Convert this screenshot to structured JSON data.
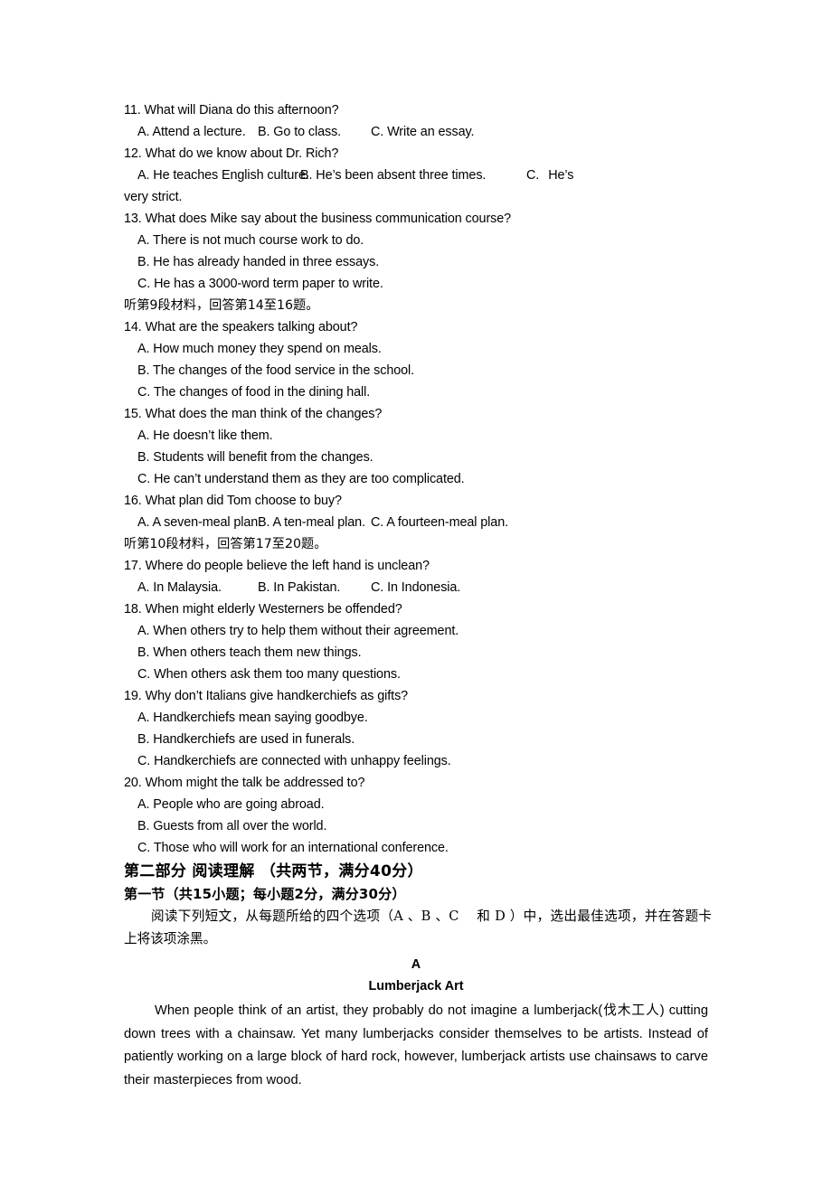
{
  "listening_questions": [
    {
      "id": "q11",
      "prompt": "11. What will Diana do this afternoon?",
      "layout": "row",
      "options": [
        "A. Attend a lecture.",
        "B. Go to class.",
        "C. Write an essay."
      ]
    },
    {
      "id": "q12",
      "prompt": "12. What do we know about Dr. Rich?",
      "layout": "row-wide",
      "options": [
        "A. He teaches English culture.",
        "B. He’s been absent three times.",
        "C.",
        "He’s"
      ],
      "continuation": "very strict."
    },
    {
      "id": "q13",
      "prompt": "13. What does Mike say about the business communication course?",
      "layout": "stacked",
      "options": [
        "A. There is not much course work to do.",
        "B. He has already handed in three essays.",
        "C. He has a 3000-word term paper to write."
      ]
    }
  ],
  "directive_9": "听第9段材料，回答第14至16题。",
  "listening_questions_2": [
    {
      "id": "q14",
      "prompt": "14. What are the speakers talking about?",
      "layout": "stacked",
      "options": [
        "A. How much money they spend on meals.",
        "B. The changes of the food service in the school.",
        "C. The changes of food in the dining hall."
      ]
    },
    {
      "id": "q15",
      "prompt": "15. What does the man think of the changes?",
      "layout": "stacked",
      "options": [
        "A. He doesn’t like them.",
        "B. Students will benefit from the changes.",
        "C. He can’t understand them as they are too complicated."
      ]
    },
    {
      "id": "q16",
      "prompt": "16. What plan did Tom choose to buy?",
      "layout": "row",
      "options": [
        "A. A seven-meal plan.",
        "B. A ten-meal plan.",
        "C. A fourteen-meal plan."
      ]
    }
  ],
  "directive_10": "听第10段材料，回答第17至20题。",
  "listening_questions_3": [
    {
      "id": "q17",
      "prompt": "17. Where do people believe the left hand is unclean?",
      "layout": "row",
      "options": [
        "A. In Malaysia.",
        "B. In Pakistan.",
        "C. In Indonesia."
      ]
    },
    {
      "id": "q18",
      "prompt": "18. When might elderly Westerners be offended?",
      "layout": "stacked",
      "options": [
        "A. When others try to help them without their agreement.",
        "B. When others teach them new things.",
        "C. When others ask them too many questions."
      ]
    },
    {
      "id": "q19",
      "prompt": "19. Why don’t Italians give handkerchiefs as gifts?",
      "layout": "stacked",
      "options": [
        "A. Handkerchiefs mean saying goodbye.",
        "B. Handkerchiefs are used in funerals.",
        "C. Handkerchiefs are connected with unhappy feelings."
      ]
    },
    {
      "id": "q20",
      "prompt": "20. Whom might the talk be addressed to?",
      "layout": "stacked",
      "options": [
        "A. People who are going abroad.",
        "B. Guests from all over the world.",
        "C. Those who will work for an international conference."
      ]
    }
  ],
  "part_two": {
    "heading": "第二部分  阅读理解  （共两节，满分40分）",
    "section_heading": "第一节（共15小题；每小题2分，满分30分）",
    "instruction": "阅读下列短文，从每题所给的四个选项（A 、B 、C 　和 D ）中，选出最佳选项，并在答题卡上将该项涂黑。"
  },
  "passage": {
    "label": "A",
    "title": "Lumberjack Art",
    "body_pre": "When people think of an artist, they probably do not imagine a lumberjack(",
    "body_gloss": "伐木工人",
    "body_post": ") cutting down trees with a chainsaw. Yet many lumberjacks consider themselves to be artists. Instead of patiently working on a large block of hard rock, however, lumberjack artists use chainsaws to carve their masterpieces from wood."
  }
}
